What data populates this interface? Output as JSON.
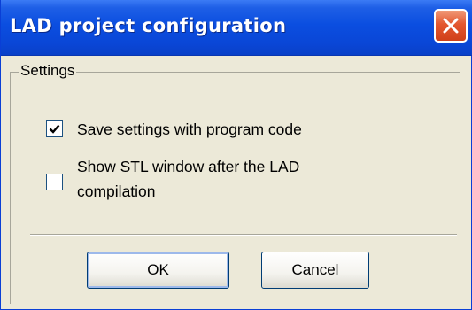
{
  "window": {
    "title": "LAD project configuration"
  },
  "settings": {
    "group_label": "Settings",
    "options": [
      {
        "label": "Save settings with program code",
        "checked": true
      },
      {
        "label_line1": "Show STL window after the LAD",
        "label_line2": "compilation",
        "checked": false
      }
    ]
  },
  "buttons": {
    "ok_label": "OK",
    "cancel_label": "Cancel"
  },
  "colors": {
    "title_bar": "#0a46d6",
    "dialog_bg": "#ece9d8",
    "close_button": "#e3572f"
  }
}
